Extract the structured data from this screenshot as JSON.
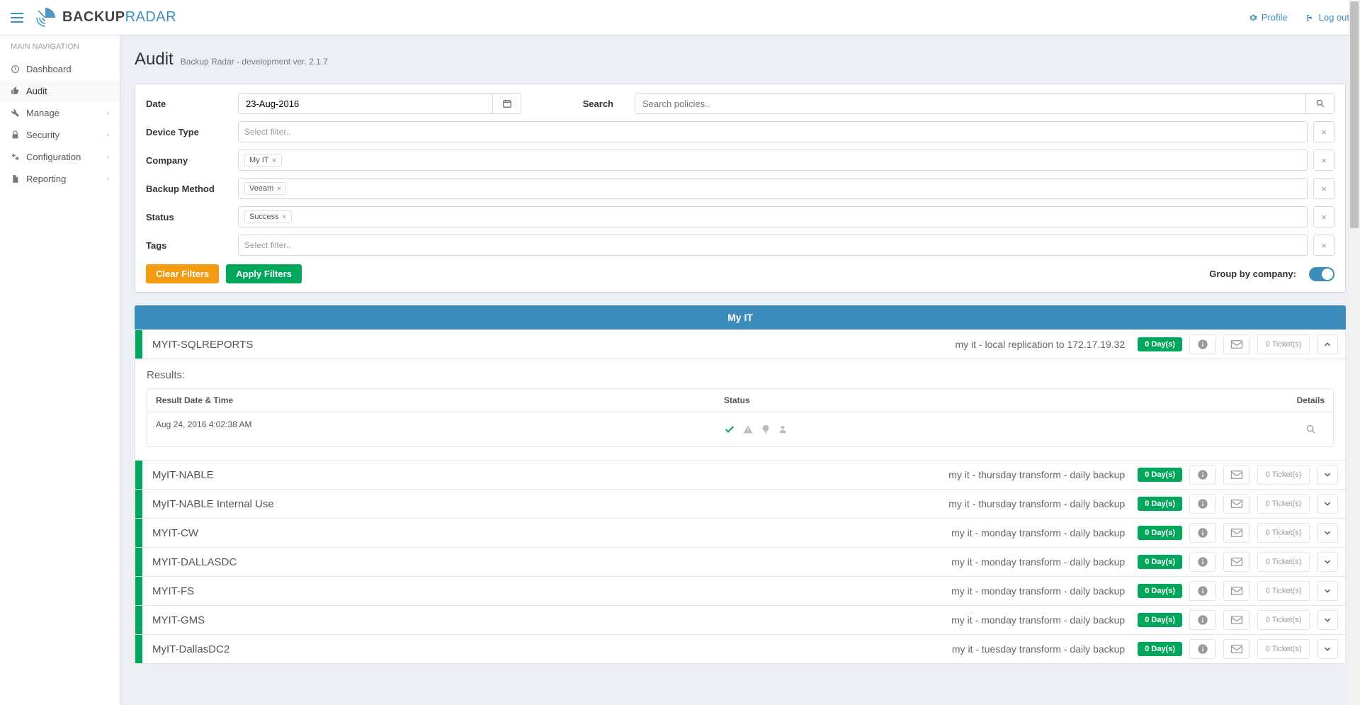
{
  "brand": {
    "part1": "BACKUP",
    "part2": "RADAR"
  },
  "top": {
    "profile": "Profile",
    "logout": "Log out"
  },
  "nav": {
    "header": "MAIN NAVIGATION",
    "items": [
      {
        "label": "Dashboard",
        "icon": "clock"
      },
      {
        "label": "Audit",
        "icon": "thumbs-up",
        "active": true
      },
      {
        "label": "Manage",
        "icon": "wrench",
        "hasChildren": true
      },
      {
        "label": "Security",
        "icon": "lock",
        "hasChildren": true
      },
      {
        "label": "Configuration",
        "icon": "cogs",
        "hasChildren": true
      },
      {
        "label": "Reporting",
        "icon": "file",
        "hasChildren": true
      }
    ]
  },
  "page": {
    "title": "Audit",
    "subtitle": "Backup Radar - development ver. 2.1.7"
  },
  "filters": {
    "date_label": "Date",
    "date_value": "23-Aug-2016",
    "search_label": "Search",
    "search_placeholder": "Search policies..",
    "device_type_label": "Device Type",
    "device_type_placeholder": "Select filter..",
    "company_label": "Company",
    "company_tags": [
      "My IT"
    ],
    "backup_method_label": "Backup Method",
    "backup_method_tags": [
      "Veeam"
    ],
    "status_label": "Status",
    "status_tags": [
      "Success"
    ],
    "tags_label": "Tags",
    "tags_placeholder": "Select filter..",
    "clear": "Clear Filters",
    "apply": "Apply Filters",
    "group_by": "Group by company:"
  },
  "group": {
    "name": "My IT"
  },
  "expanded": {
    "results_label": "Results:",
    "col_date": "Result Date & Time",
    "col_status": "Status",
    "col_details": "Details",
    "row_datetime": "Aug 24, 2016 4:02:38 AM"
  },
  "rows": [
    {
      "name": "MYIT-SQLREPORTS",
      "desc": "my it - local replication to 172.17.19.32",
      "days": "0  Day(s)",
      "tickets": "0 Ticket(s)",
      "expanded": true
    },
    {
      "name": "MyIT-NABLE",
      "desc": "my it - thursday transform - daily backup",
      "days": "0  Day(s)",
      "tickets": "0 Ticket(s)"
    },
    {
      "name": "MyIT-NABLE Internal Use",
      "desc": "my it - thursday transform - daily backup",
      "days": "0  Day(s)",
      "tickets": "0 Ticket(s)"
    },
    {
      "name": "MYIT-CW",
      "desc": "my it - monday transform - daily backup",
      "days": "0  Day(s)",
      "tickets": "0 Ticket(s)"
    },
    {
      "name": "MYIT-DALLASDC",
      "desc": "my it - monday transform - daily backup",
      "days": "0  Day(s)",
      "tickets": "0 Ticket(s)"
    },
    {
      "name": "MYIT-FS",
      "desc": "my it - monday transform - daily backup",
      "days": "0  Day(s)",
      "tickets": "0 Ticket(s)"
    },
    {
      "name": "MYIT-GMS",
      "desc": "my it - monday transform - daily backup",
      "days": "0  Day(s)",
      "tickets": "0 Ticket(s)"
    },
    {
      "name": "MyIT-DallasDC2",
      "desc": "my it - tuesday transform - daily backup",
      "days": "0  Day(s)",
      "tickets": "0 Ticket(s)"
    }
  ]
}
